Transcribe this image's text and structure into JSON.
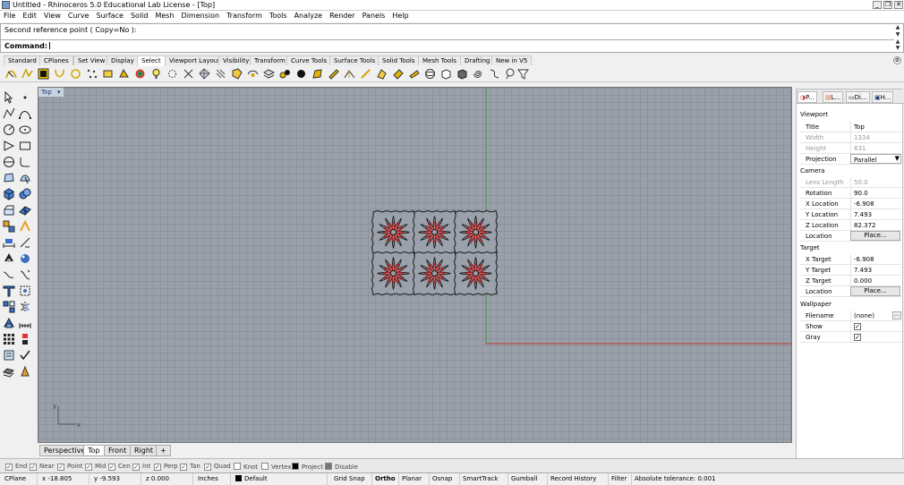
{
  "window": {
    "title": "Untitled - Rhinoceros 5.0 Educational Lab License - [Top]"
  },
  "menu": [
    "File",
    "Edit",
    "View",
    "Curve",
    "Surface",
    "Solid",
    "Mesh",
    "Dimension",
    "Transform",
    "Tools",
    "Analyze",
    "Render",
    "Panels",
    "Help"
  ],
  "command": {
    "history": "Second reference point ( Copy=No ):",
    "prompt": "Command:"
  },
  "toolbar_tabs": [
    "Standard",
    "CPlanes",
    "Set View",
    "Display",
    "Select",
    "Viewport Layout",
    "Visibility",
    "Transform",
    "Curve Tools",
    "Surface Tools",
    "Solid Tools",
    "Mesh Tools",
    "Drafting",
    "New in V5"
  ],
  "active_toolbar_tab": "Select",
  "viewport": {
    "label": "Top",
    "axis_x": "x",
    "axis_y": "y"
  },
  "viewport_tabs": [
    "Perspective",
    "Top",
    "Front",
    "Right"
  ],
  "viewport_tab_add": "+",
  "active_viewport_tab": "Top",
  "panel": {
    "tabs": [
      "P...",
      "L...",
      "Di...",
      "H..."
    ],
    "sections": {
      "viewport": "Viewport",
      "camera": "Camera",
      "target": "Target",
      "wallpaper": "Wallpaper"
    },
    "viewport_props": [
      {
        "k": "Title",
        "v": "Top"
      },
      {
        "k": "Width",
        "v": "1334",
        "disabled": true
      },
      {
        "k": "Height",
        "v": "631",
        "disabled": true
      },
      {
        "k": "Projection",
        "v": "Parallel"
      }
    ],
    "camera_props": [
      {
        "k": "Lens Length",
        "v": "50.0",
        "disabled": true
      },
      {
        "k": "Rotation",
        "v": "90.0"
      },
      {
        "k": "X Location",
        "v": "-6.908"
      },
      {
        "k": "Y Location",
        "v": "7.493"
      },
      {
        "k": "Z Location",
        "v": "82.372"
      },
      {
        "k": "Location",
        "v": "Place..."
      }
    ],
    "target_props": [
      {
        "k": "X Target",
        "v": "-6.908"
      },
      {
        "k": "Y Target",
        "v": "7.493"
      },
      {
        "k": "Z Target",
        "v": "0.000"
      },
      {
        "k": "Location",
        "v": "Place..."
      }
    ],
    "wallpaper_props": [
      {
        "k": "Filename",
        "v": "(none)"
      },
      {
        "k": "Show",
        "v": "✓"
      },
      {
        "k": "Gray",
        "v": "✓"
      }
    ],
    "filename_button": "..."
  },
  "osnaps": [
    {
      "label": "End",
      "checked": true
    },
    {
      "label": "Near",
      "checked": true
    },
    {
      "label": "Point",
      "checked": true
    },
    {
      "label": "Mid",
      "checked": true
    },
    {
      "label": "Cen",
      "checked": true
    },
    {
      "label": "Int",
      "checked": true
    },
    {
      "label": "Perp",
      "checked": true
    },
    {
      "label": "Tan",
      "checked": true
    },
    {
      "label": "Quad",
      "checked": true
    },
    {
      "label": "Knot",
      "checked": false
    },
    {
      "label": "Vertex",
      "checked": false
    },
    {
      "label": "Project",
      "checked": false
    },
    {
      "label": "Disable",
      "checked": false
    }
  ],
  "status": {
    "cplane": "CPlane",
    "x": "x -18.805",
    "y": "y -9.593",
    "z": "z 0.000",
    "units": "Inches",
    "layer": "Default",
    "grid_snap": "Grid Snap",
    "ortho": "Ortho",
    "planar": "Planar",
    "osnap": "Osnap",
    "smarttrack": "SmartTrack",
    "gumball": "Gumball",
    "record_history": "Record History",
    "filter": "Filter",
    "tolerance": "Absolute tolerance: 0.001"
  },
  "colors": {
    "curve": "#1a1a1a",
    "petal": "#d42a2a",
    "x_axis": "#c0392b",
    "y_axis": "#2f9e3f",
    "viewport_bg": "#99a0aa"
  }
}
